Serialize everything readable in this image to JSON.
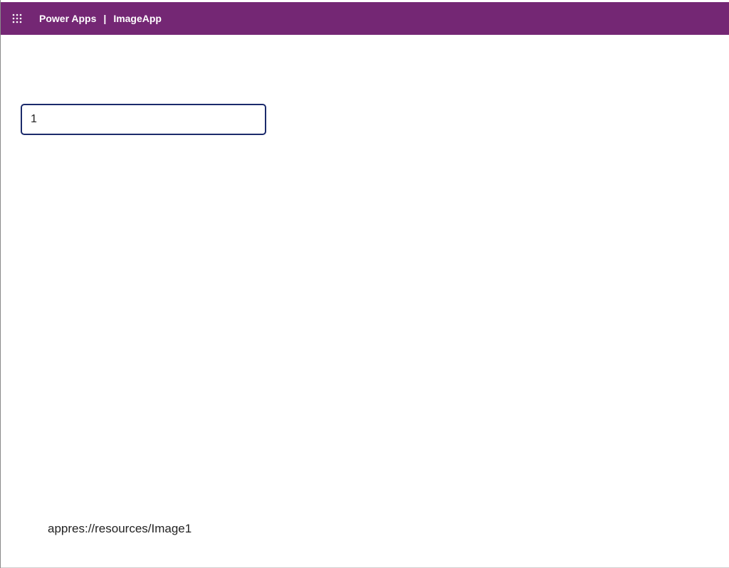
{
  "header": {
    "app_title": "Power Apps",
    "separator": "|",
    "app_name": "ImageApp",
    "icon": "waffle-icon",
    "background_color": "#742774"
  },
  "text_input": {
    "value": "1",
    "border_color": "#1b2a6b"
  },
  "image_label": {
    "text": "appres://resources/Image1"
  }
}
